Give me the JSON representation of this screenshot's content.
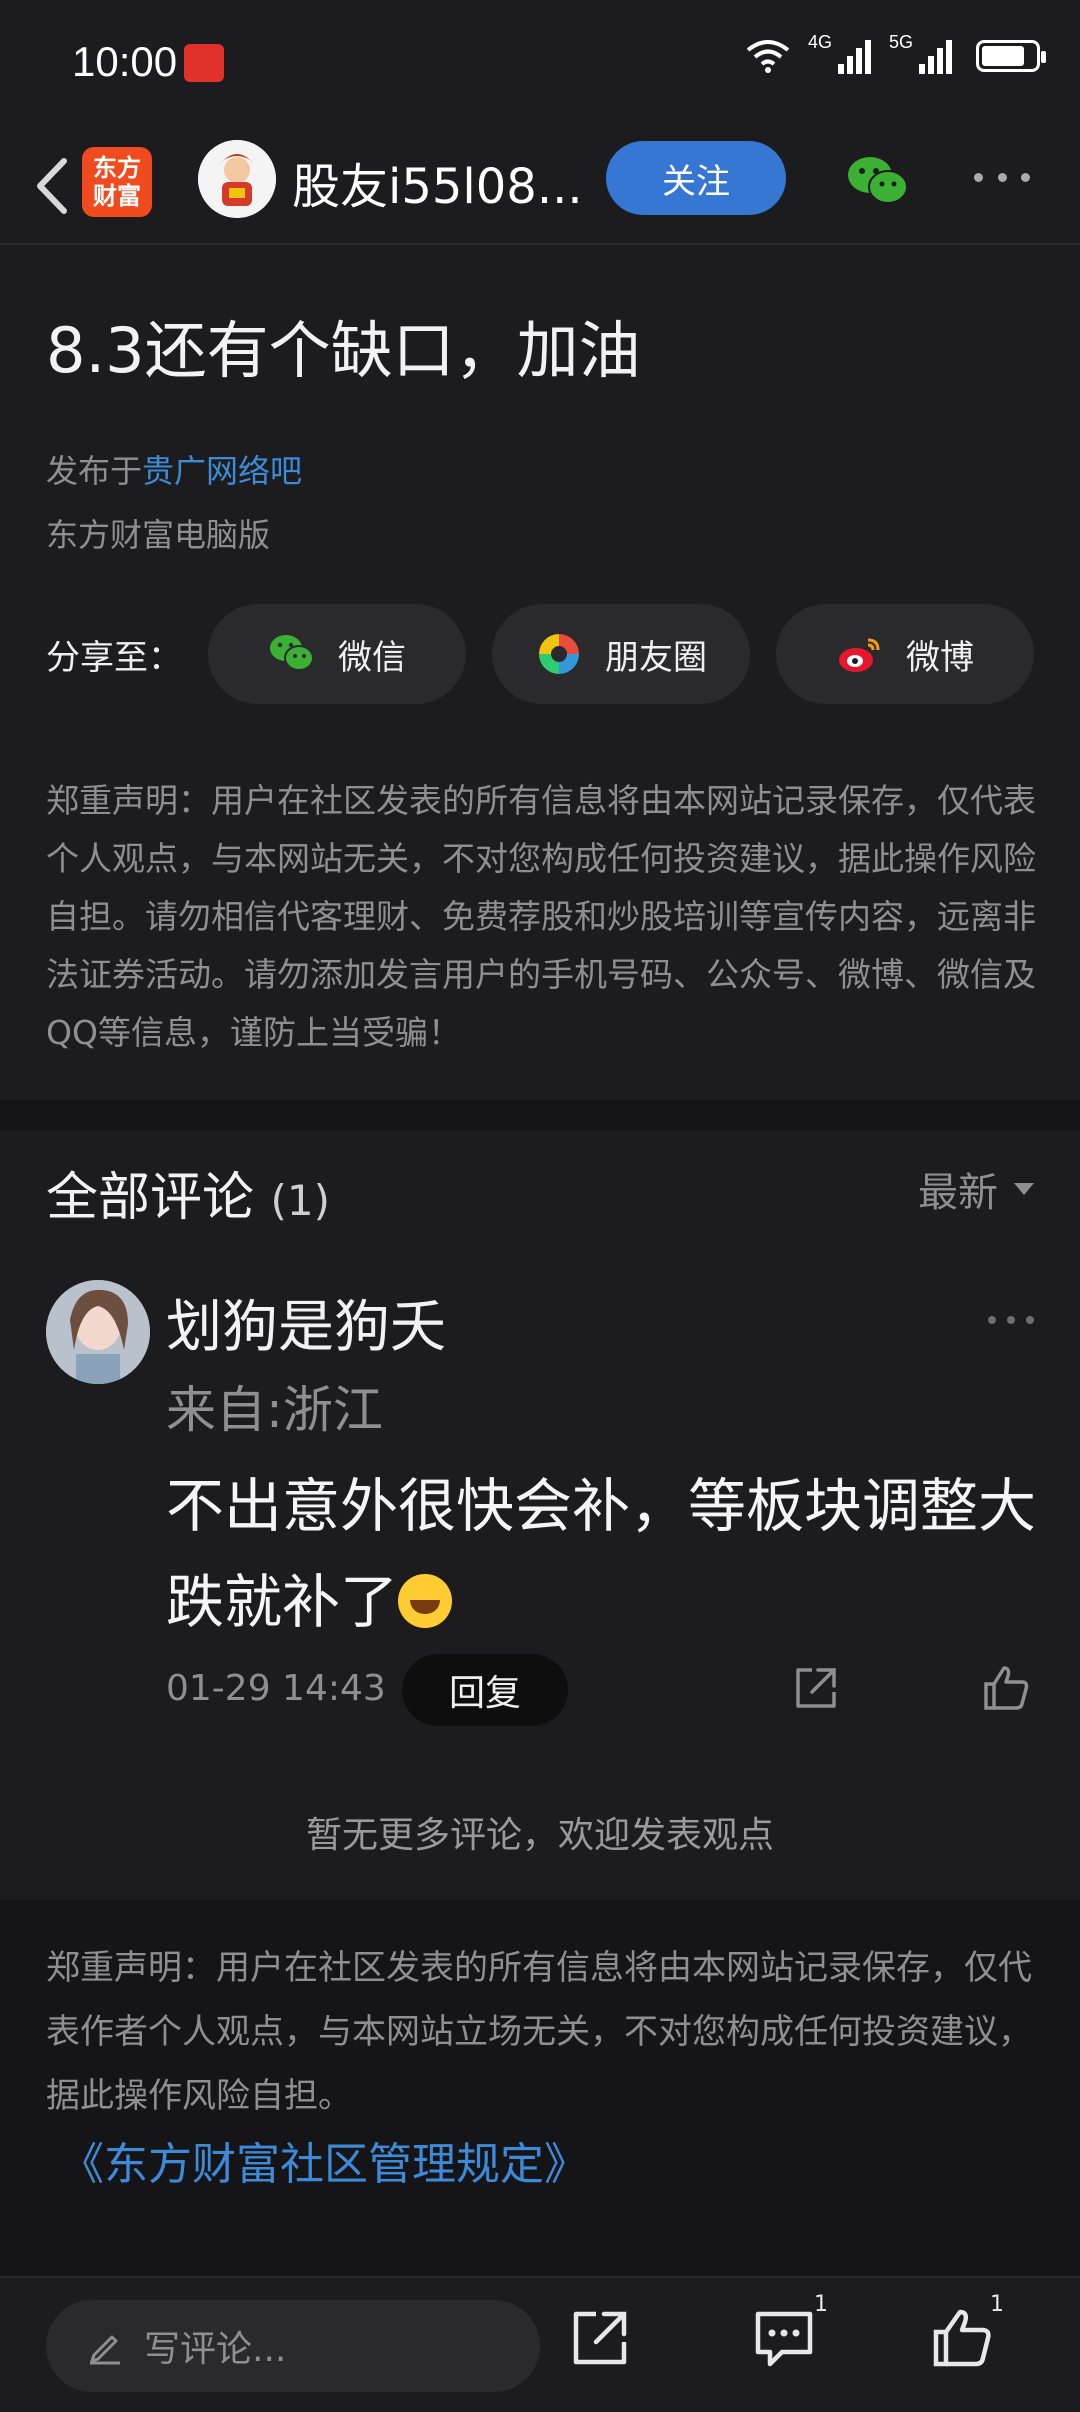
{
  "status_bar": {
    "time": "10:00",
    "network_1": "4G",
    "network_2": "5G",
    "battery_level": 0.8
  },
  "nav": {
    "logo_text": "东方\n财富",
    "username": "股友i55l08...",
    "follow_label": "关注"
  },
  "post": {
    "title": "8.3还有个缺口，加油",
    "posted_in_prefix": "发布于",
    "posted_in_forum": "贵广网络吧",
    "platform": "东方财富电脑版"
  },
  "share": {
    "label": "分享至：",
    "options": [
      {
        "label": "微信",
        "icon": "wechat-icon"
      },
      {
        "label": "朋友圈",
        "icon": "moments-icon"
      },
      {
        "label": "微博",
        "icon": "weibo-icon"
      }
    ]
  },
  "disclaimer_top": "郑重声明：用户在社区发表的所有信息将由本网站记录保存，仅代表个人观点，与本网站无关，不对您构成任何投资建议，据此操作风险自担。请勿相信代客理财、免费荐股和炒股培训等宣传内容，远离非法证券活动。请勿添加发言用户的手机号码、公众号、微博、微信及QQ等信息，谨防上当受骗！",
  "comments": {
    "title": "全部评论",
    "count": "(1)",
    "sort_label": "最新",
    "items": [
      {
        "name": "划狗是狗夭",
        "location": "来自:浙江",
        "text": "不出意外很快会补，等板块调整大跌就补了",
        "time": "01-29 14:43",
        "reply_label": "回复"
      }
    ],
    "no_more": "暂无更多评论，欢迎发表观点"
  },
  "disclaimer_bottom": "郑重声明：用户在社区发表的所有信息将由本网站记录保存，仅代表作者个人观点，与本网站立场无关，不对您构成任何投资建议，据此操作风险自担。",
  "rules_link": "《东方财富社区管理规定》",
  "bottom_bar": {
    "comment_placeholder": "写评论...",
    "comment_count": "1",
    "like_count": "1"
  }
}
